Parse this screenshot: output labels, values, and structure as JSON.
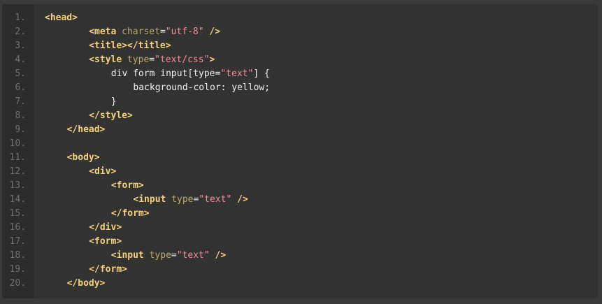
{
  "theme": {
    "background": "#333333",
    "gutter": "#2c2c2c",
    "tag_color": "#f5d27a",
    "attribute_color": "#bca96d",
    "string_color": "#ef8d9a",
    "text_color": "#f0f0f0",
    "line_number_color": "#6f6f6f"
  },
  "code_lines": [
    {
      "number": "1.",
      "indent": 0,
      "tokens": [
        {
          "type": "tag",
          "text": "<head>"
        }
      ]
    },
    {
      "number": "2.",
      "indent": 8,
      "tokens": [
        {
          "type": "tag",
          "text": "<meta "
        },
        {
          "type": "attr",
          "text": "charset"
        },
        {
          "type": "plain",
          "text": "="
        },
        {
          "type": "str",
          "text": "\"utf-8\""
        },
        {
          "type": "tag",
          "text": " />"
        }
      ]
    },
    {
      "number": "3.",
      "indent": 8,
      "tokens": [
        {
          "type": "tag",
          "text": "<title></title>"
        }
      ]
    },
    {
      "number": "4.",
      "indent": 8,
      "tokens": [
        {
          "type": "tag",
          "text": "<style "
        },
        {
          "type": "attr",
          "text": "type"
        },
        {
          "type": "plain",
          "text": "="
        },
        {
          "type": "str",
          "text": "\"text/css\""
        },
        {
          "type": "tag",
          "text": ">"
        }
      ]
    },
    {
      "number": "5.",
      "indent": 12,
      "tokens": [
        {
          "type": "plain",
          "text": "div form input[type="
        },
        {
          "type": "str",
          "text": "\"text\""
        },
        {
          "type": "plain",
          "text": "] {"
        }
      ]
    },
    {
      "number": "6.",
      "indent": 16,
      "tokens": [
        {
          "type": "plain",
          "text": "background-color: yellow;"
        }
      ]
    },
    {
      "number": "7.",
      "indent": 12,
      "tokens": [
        {
          "type": "plain",
          "text": "}"
        }
      ]
    },
    {
      "number": "8.",
      "indent": 8,
      "tokens": [
        {
          "type": "tag",
          "text": "</style>"
        }
      ]
    },
    {
      "number": "9.",
      "indent": 4,
      "tokens": [
        {
          "type": "tag",
          "text": "</head>"
        }
      ]
    },
    {
      "number": "10.",
      "indent": 0,
      "tokens": []
    },
    {
      "number": "11.",
      "indent": 4,
      "tokens": [
        {
          "type": "tag",
          "text": "<body>"
        }
      ]
    },
    {
      "number": "12.",
      "indent": 8,
      "tokens": [
        {
          "type": "tag",
          "text": "<div>"
        }
      ]
    },
    {
      "number": "13.",
      "indent": 12,
      "tokens": [
        {
          "type": "tag",
          "text": "<form>"
        }
      ]
    },
    {
      "number": "14.",
      "indent": 16,
      "tokens": [
        {
          "type": "tag",
          "text": "<input "
        },
        {
          "type": "attr",
          "text": "type"
        },
        {
          "type": "plain",
          "text": "="
        },
        {
          "type": "str",
          "text": "\"text\""
        },
        {
          "type": "tag",
          "text": " />"
        }
      ]
    },
    {
      "number": "15.",
      "indent": 12,
      "tokens": [
        {
          "type": "tag",
          "text": "</form>"
        }
      ]
    },
    {
      "number": "16.",
      "indent": 8,
      "tokens": [
        {
          "type": "tag",
          "text": "</div>"
        }
      ]
    },
    {
      "number": "17.",
      "indent": 8,
      "tokens": [
        {
          "type": "tag",
          "text": "<form>"
        }
      ]
    },
    {
      "number": "18.",
      "indent": 12,
      "tokens": [
        {
          "type": "tag",
          "text": "<input "
        },
        {
          "type": "attr",
          "text": "type"
        },
        {
          "type": "plain",
          "text": "="
        },
        {
          "type": "str",
          "text": "\"text\""
        },
        {
          "type": "tag",
          "text": " />"
        }
      ]
    },
    {
      "number": "19.",
      "indent": 8,
      "tokens": [
        {
          "type": "tag",
          "text": "</form>"
        }
      ]
    },
    {
      "number": "20.",
      "indent": 4,
      "tokens": [
        {
          "type": "tag",
          "text": "</body>"
        }
      ]
    }
  ]
}
